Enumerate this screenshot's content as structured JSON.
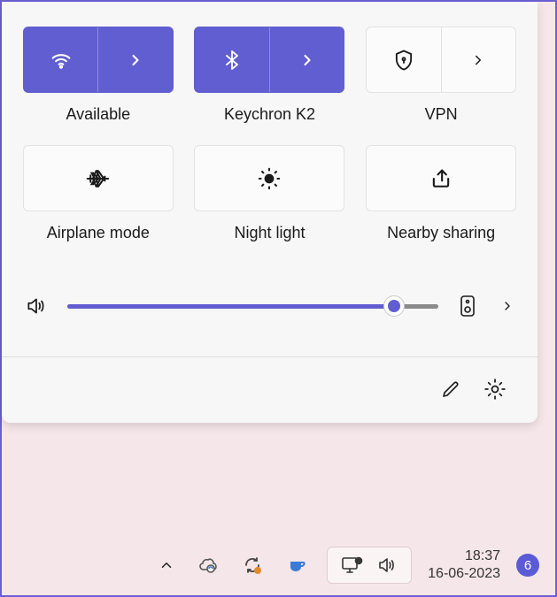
{
  "tiles": [
    {
      "label": "Available",
      "icon": "wifi-icon",
      "active": true,
      "split": true
    },
    {
      "label": "Keychron K2",
      "icon": "bluetooth-icon",
      "active": true,
      "split": true
    },
    {
      "label": "VPN",
      "icon": "shield-lock-icon",
      "active": false,
      "split": true
    },
    {
      "label": "Airplane mode",
      "icon": "airplane-icon",
      "active": false,
      "split": false
    },
    {
      "label": "Night light",
      "icon": "brightness-icon",
      "active": false,
      "split": false
    },
    {
      "label": "Nearby sharing",
      "icon": "share-icon",
      "active": false,
      "split": false
    }
  ],
  "volume": {
    "level": 88
  },
  "taskbar": {
    "time": "18:37",
    "date": "16-06-2023",
    "notification_count": "6"
  }
}
